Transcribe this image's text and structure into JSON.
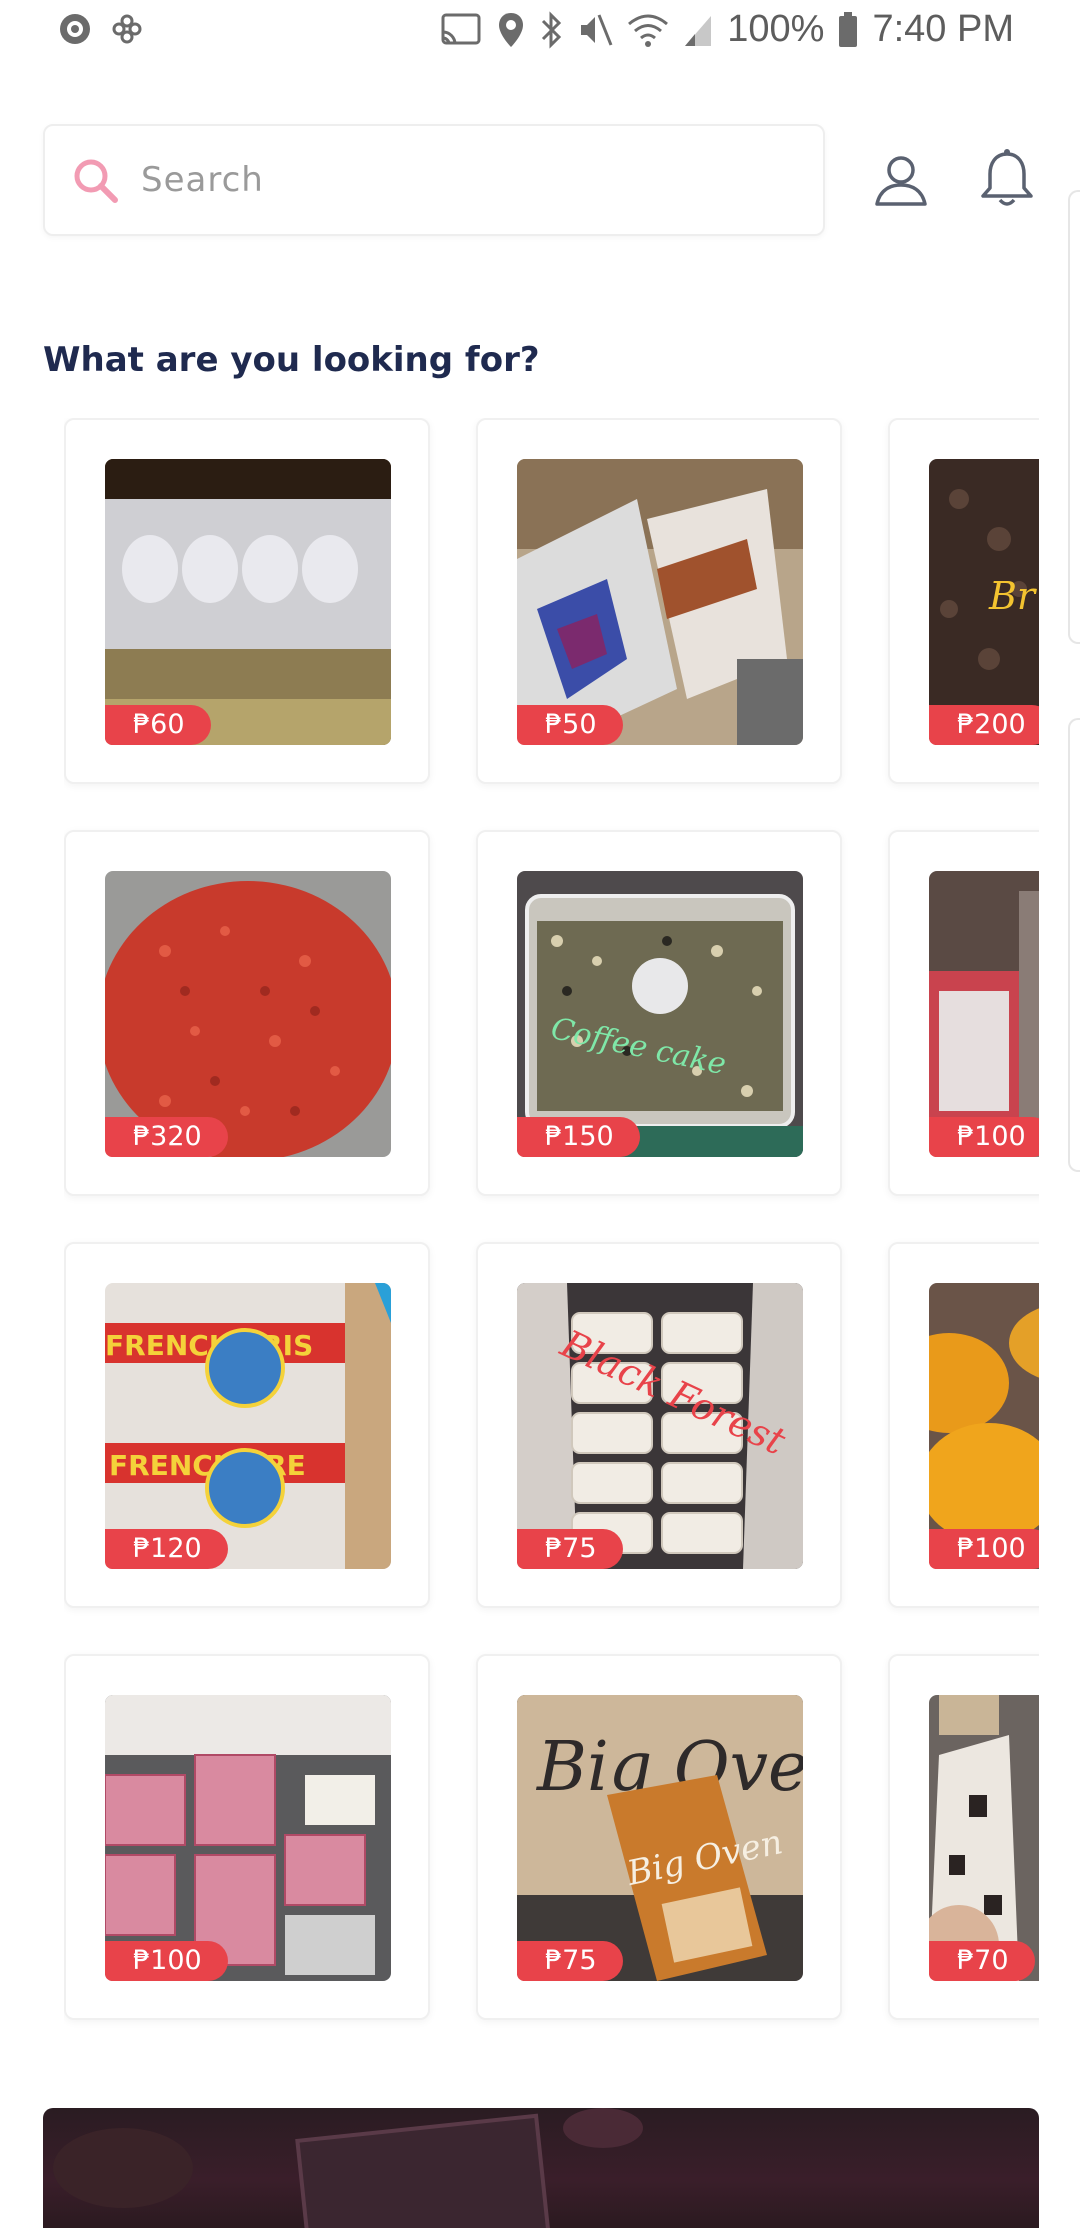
{
  "status_bar": {
    "battery": "100%",
    "time": "7:40 PM"
  },
  "search": {
    "placeholder": "Search"
  },
  "section": {
    "title": "What are you looking for?"
  },
  "products": [
    {
      "price": "₱60"
    },
    {
      "price": "₱50"
    },
    {
      "price": "₱200"
    },
    {
      "price": "₱320"
    },
    {
      "price": "₱150"
    },
    {
      "price": "₱100"
    },
    {
      "price": "₱120"
    },
    {
      "price": "₱75"
    },
    {
      "price": "₱100"
    },
    {
      "price": "₱100"
    },
    {
      "price": "₱75"
    },
    {
      "price": "₱70"
    }
  ],
  "colors": {
    "accent_pink": "#f29bb3",
    "price_badge": "#e8434a",
    "title_navy": "#1f2a4f"
  }
}
